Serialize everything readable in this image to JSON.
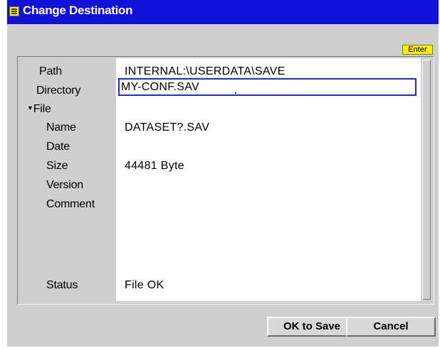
{
  "window": {
    "title": "Change Destination",
    "title_icon": "dialog-menu-icon",
    "titlebar_color": "#1010d8"
  },
  "fields": {
    "path_label": "Path",
    "path_value": "INTERNAL:\\USERDATA\\SAVE",
    "directory_label": "Directory",
    "directory_value": "MY-CONF.SAV",
    "file_group_label": "File",
    "file_group_icon": "triangle-down-icon",
    "name_label": "Name",
    "name_value": "DATASET?.SAV",
    "date_label": "Date",
    "date_value": "",
    "size_label": "Size",
    "size_value": "44481 Byte",
    "version_label": "Version",
    "version_value": "",
    "comment_label": "Comment",
    "comment_value": "",
    "status_label": "Status",
    "status_value": "File OK"
  },
  "hint": {
    "enter_badge": "Enter",
    "badge_color": "#f8f000"
  },
  "buttons": {
    "ok_label": "OK to Save",
    "cancel_label": "Cancel"
  }
}
